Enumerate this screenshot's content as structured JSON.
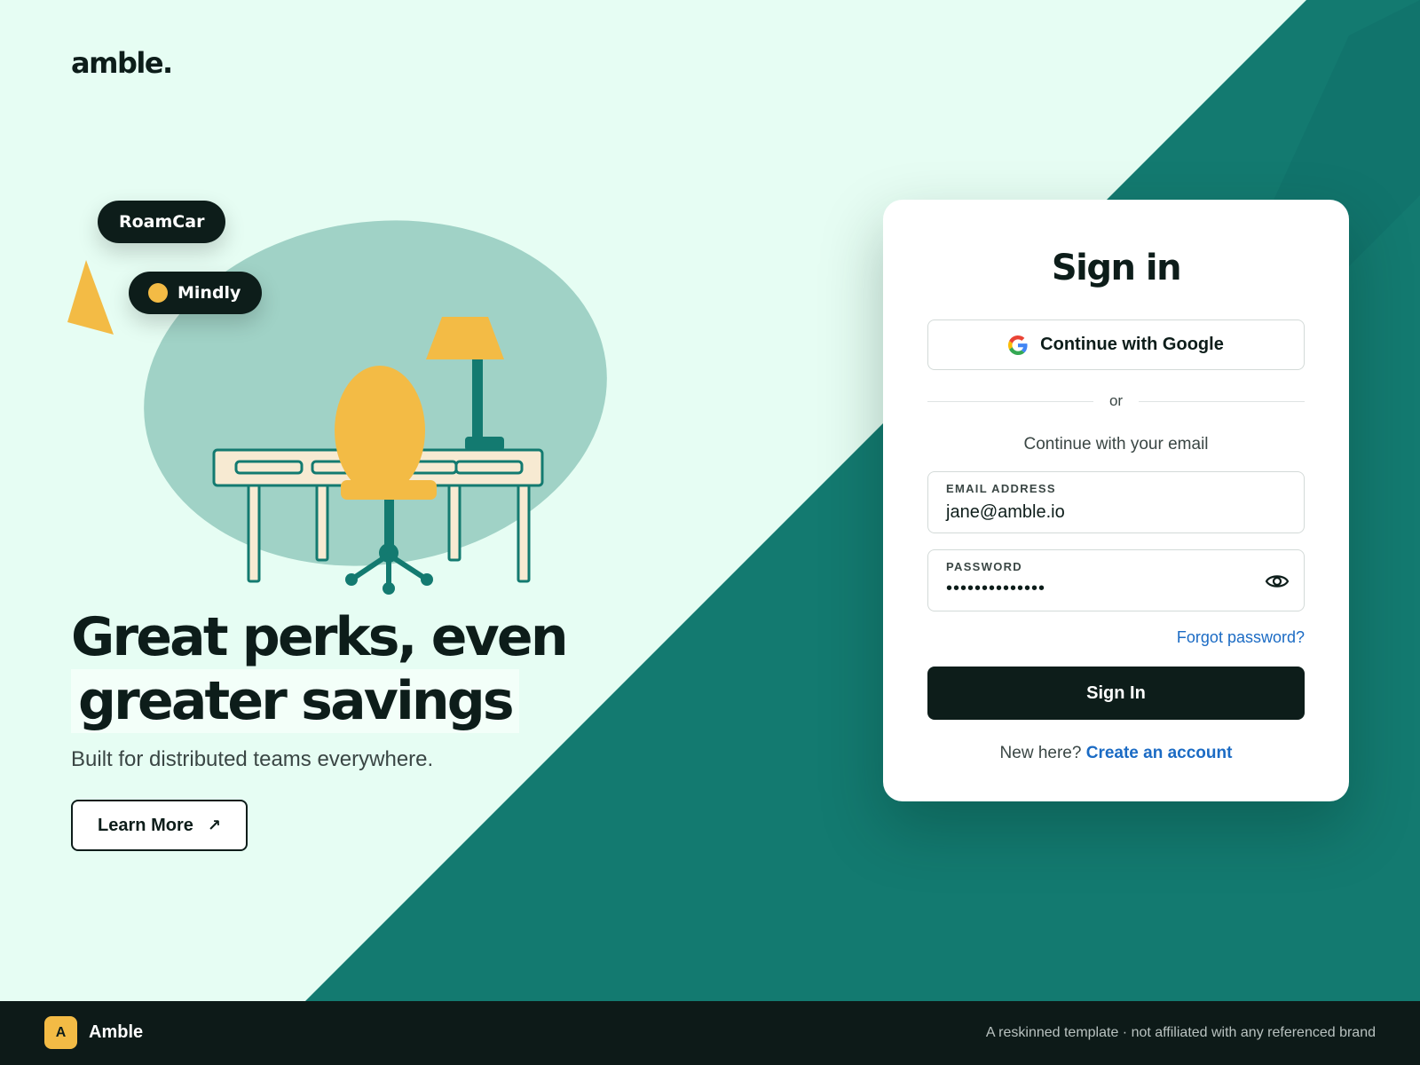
{
  "brand": {
    "logo": "amble."
  },
  "hero": {
    "chips": [
      {
        "label": "RoamCar"
      },
      {
        "label": "Mindly"
      }
    ],
    "headline_line1": "Great perks, even",
    "headline_line2": "greater savings",
    "subhead": "Built for distributed teams everywhere.",
    "learn_more_label": "Learn More",
    "learn_more_icon": "arrow-up-right-icon"
  },
  "signin": {
    "title": "Sign in",
    "google_label": "Continue with Google",
    "divider_text": "or",
    "email_caption": "Continue with your email",
    "email_label": "EMAIL ADDRESS",
    "email_value": "jane@amble.io",
    "password_label": "PASSWORD",
    "password_value": "••••••••••••••",
    "password_toggle_icon": "eye-icon",
    "forgot_label": "Forgot password?",
    "submit_label": "Sign In",
    "new_here_text": "New here?",
    "create_account_label": "Create an account"
  },
  "footer": {
    "badge": "A",
    "name": "Amble",
    "note": "A reskinned template · not affiliated with any referenced brand"
  },
  "colors": {
    "page_bg": "#e6fdf3",
    "teal": "#137a70",
    "dark": "#0d1d1a",
    "accent_yellow": "#f3bb45",
    "link_blue": "#1b6bc4"
  }
}
